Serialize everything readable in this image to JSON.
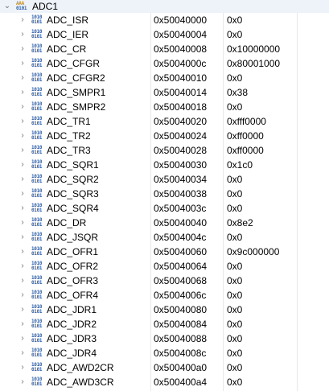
{
  "peripheral": {
    "name": "ADC1",
    "expanded_glyph": "⌄",
    "icon": "peripheral-icon",
    "icon_bits_top": "AAA",
    "icon_bits_bottom": "0101"
  },
  "register_icon": {
    "name": "register-binary-icon",
    "bits_top": "1010",
    "bits_bottom": "0101"
  },
  "collapsed_glyph": "›",
  "registers": [
    {
      "name": "ADC_ISR",
      "address": "0x50040000",
      "value": "0x0"
    },
    {
      "name": "ADC_IER",
      "address": "0x50040004",
      "value": "0x0"
    },
    {
      "name": "ADC_CR",
      "address": "0x50040008",
      "value": "0x10000000"
    },
    {
      "name": "ADC_CFGR",
      "address": "0x5004000c",
      "value": "0x80001000"
    },
    {
      "name": "ADC_CFGR2",
      "address": "0x50040010",
      "value": "0x0"
    },
    {
      "name": "ADC_SMPR1",
      "address": "0x50040014",
      "value": "0x38"
    },
    {
      "name": "ADC_SMPR2",
      "address": "0x50040018",
      "value": "0x0"
    },
    {
      "name": "ADC_TR1",
      "address": "0x50040020",
      "value": "0xfff0000"
    },
    {
      "name": "ADC_TR2",
      "address": "0x50040024",
      "value": "0xff0000"
    },
    {
      "name": "ADC_TR3",
      "address": "0x50040028",
      "value": "0xff0000"
    },
    {
      "name": "ADC_SQR1",
      "address": "0x50040030",
      "value": "0x1c0"
    },
    {
      "name": "ADC_SQR2",
      "address": "0x50040034",
      "value": "0x0"
    },
    {
      "name": "ADC_SQR3",
      "address": "0x50040038",
      "value": "0x0"
    },
    {
      "name": "ADC_SQR4",
      "address": "0x5004003c",
      "value": "0x0"
    },
    {
      "name": "ADC_DR",
      "address": "0x50040040",
      "value": "0x8e2"
    },
    {
      "name": "ADC_JSQR",
      "address": "0x5004004c",
      "value": "0x0"
    },
    {
      "name": "ADC_OFR1",
      "address": "0x50040060",
      "value": "0x9c000000"
    },
    {
      "name": "ADC_OFR2",
      "address": "0x50040064",
      "value": "0x0"
    },
    {
      "name": "ADC_OFR3",
      "address": "0x50040068",
      "value": "0x0"
    },
    {
      "name": "ADC_OFR4",
      "address": "0x5004006c",
      "value": "0x0"
    },
    {
      "name": "ADC_JDR1",
      "address": "0x50040080",
      "value": "0x0"
    },
    {
      "name": "ADC_JDR2",
      "address": "0x50040084",
      "value": "0x0"
    },
    {
      "name": "ADC_JDR3",
      "address": "0x50040088",
      "value": "0x0"
    },
    {
      "name": "ADC_JDR4",
      "address": "0x5004008c",
      "value": "0x0"
    },
    {
      "name": "ADC_AWD2CR",
      "address": "0x500400a0",
      "value": "0x0"
    },
    {
      "name": "ADC_AWD3CR",
      "address": "0x500400a4",
      "value": "0x0"
    }
  ]
}
